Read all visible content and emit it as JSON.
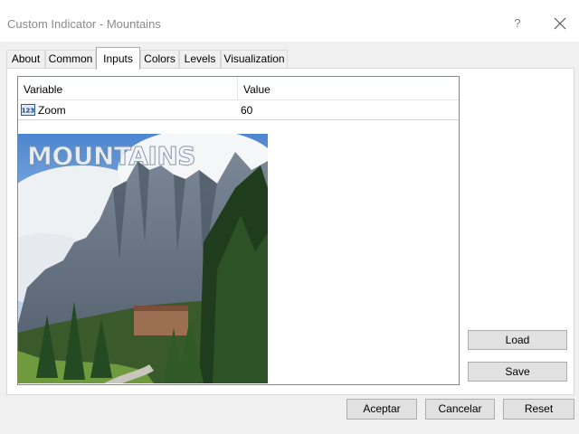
{
  "window": {
    "title": "Custom Indicator - Mountains",
    "help_glyph": "?"
  },
  "tabs": [
    {
      "label": "About"
    },
    {
      "label": "Common"
    },
    {
      "label": "Inputs",
      "active": true
    },
    {
      "label": "Colors"
    },
    {
      "label": "Levels"
    },
    {
      "label": "Visualization"
    }
  ],
  "inputs_table": {
    "headers": {
      "variable": "Variable",
      "value": "Value"
    },
    "rows": [
      {
        "icon": "numeric-123-icon",
        "variable": "Zoom",
        "value": "60"
      }
    ]
  },
  "preview": {
    "overlay_text": "MOUNTAINS"
  },
  "side_buttons": {
    "load": "Load",
    "save": "Save"
  },
  "footer_buttons": {
    "accept": "Aceptar",
    "cancel": "Cancelar",
    "reset": "Reset"
  },
  "colors": {
    "accent_border": "#0078d7",
    "dialog_bg": "#f0f0f0",
    "button_bg": "#e1e1e1"
  }
}
